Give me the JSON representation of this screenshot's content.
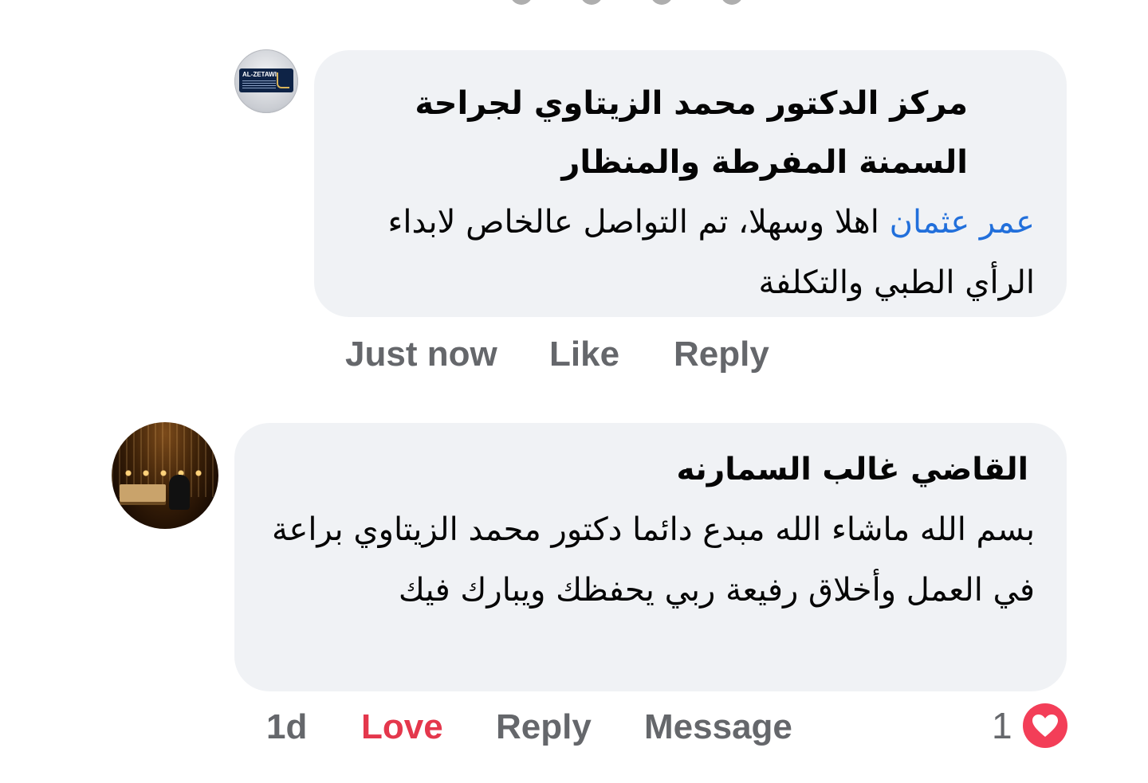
{
  "comments": [
    {
      "author": "مركز الدكتور محمد الزيتاوي لجراحة السمنة المفرطة والمنظار",
      "avatar_logo_text": "AL-ZETAWI",
      "mention": "عمر عثمان",
      "text_after_mention": " اهلا وسهلا،  تم التواصل عالخاص لابداء الرأي الطبي والتكلفة",
      "time": "Just now",
      "like_label": "Like",
      "reply_label": "Reply"
    },
    {
      "author": "القاضي غالب السمارنه",
      "text": "بسم الله ماشاء الله مبدع دائما دكتور محمد الزيتاوي براعة في العمل وأخلاق رفيعة ربي يحفظك ويبارك فيك",
      "time": "1d",
      "love_label": "Love",
      "reply_label": "Reply",
      "message_label": "Message",
      "reaction_count": "1",
      "reaction_icon": "heart-icon",
      "love_color": "#e4374c",
      "reaction_badge_color": "#f33e58"
    }
  ],
  "colors": {
    "bubble_bg": "#f0f2f5",
    "mention": "#216fdb",
    "action_text": "#65676b"
  }
}
